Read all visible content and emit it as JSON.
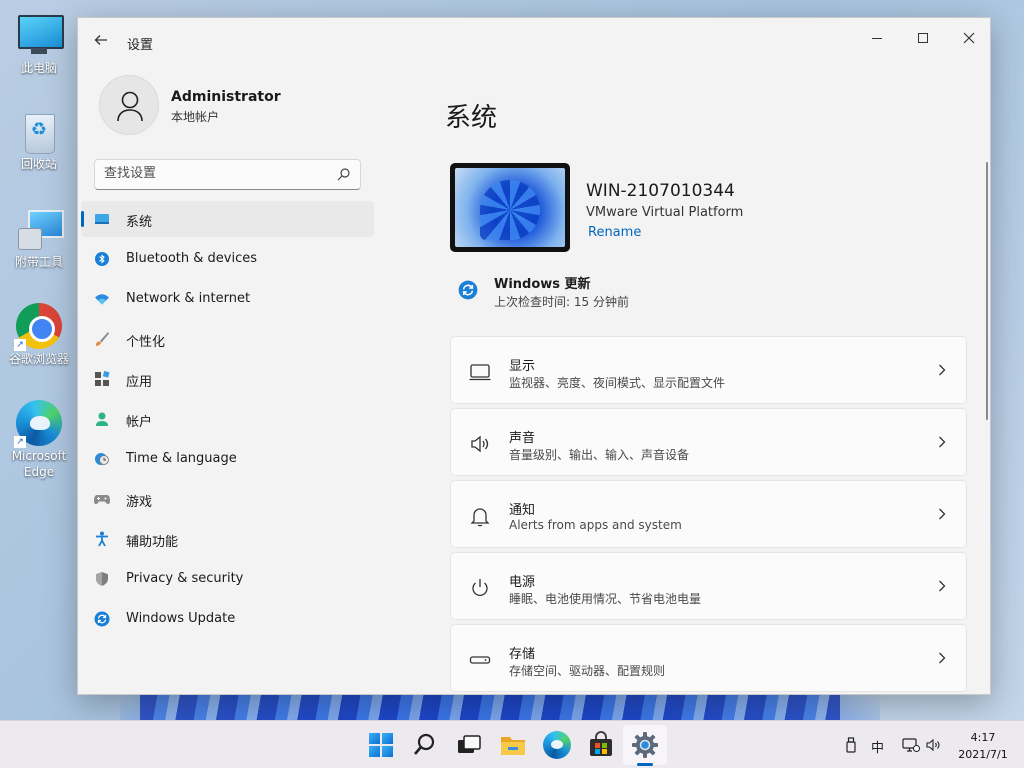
{
  "desktop": {
    "icons": [
      {
        "label": "此电脑"
      },
      {
        "label": "回收站"
      },
      {
        "label": "附带工具"
      },
      {
        "label": "谷歌浏览器"
      },
      {
        "label": "Microsoft Edge"
      }
    ]
  },
  "window": {
    "title": "设置",
    "back_icon": "arrow-left-icon",
    "controls": {
      "minimize": "minimize-icon",
      "maximize": "maximize-icon",
      "close": "close-icon"
    }
  },
  "profile": {
    "name": "Administrator",
    "account_type": "本地帐户"
  },
  "search": {
    "placeholder": "查找设置"
  },
  "nav": {
    "items": [
      {
        "label": "系统",
        "icon": "display-icon",
        "active": true
      },
      {
        "label": "Bluetooth & devices",
        "icon": "bluetooth-icon"
      },
      {
        "label": "Network & internet",
        "icon": "wifi-icon"
      },
      {
        "label": "个性化",
        "icon": "brush-icon"
      },
      {
        "label": "应用",
        "icon": "apps-icon"
      },
      {
        "label": "帐户",
        "icon": "person-icon"
      },
      {
        "label": "Time & language",
        "icon": "globe-clock-icon"
      },
      {
        "label": "游戏",
        "icon": "gamepad-icon"
      },
      {
        "label": "辅助功能",
        "icon": "accessibility-icon"
      },
      {
        "label": "Privacy & security",
        "icon": "shield-icon"
      },
      {
        "label": "Windows Update",
        "icon": "update-icon"
      }
    ]
  },
  "main": {
    "title": "系统",
    "device": {
      "name": "WIN-2107010344",
      "model": "VMware Virtual Platform",
      "rename_label": "Rename"
    },
    "update": {
      "title": "Windows 更新",
      "subtitle": "上次检查时间: 15 分钟前"
    },
    "cards": [
      {
        "title": "显示",
        "subtitle": "监视器、亮度、夜间模式、显示配置文件",
        "icon": "monitor-icon"
      },
      {
        "title": "声音",
        "subtitle": "音量级别、输出、输入、声音设备",
        "icon": "speaker-icon"
      },
      {
        "title": "通知",
        "subtitle": "Alerts from apps and system",
        "icon": "bell-icon"
      },
      {
        "title": "电源",
        "subtitle": "睡眠、电池使用情况、节省电池电量",
        "icon": "power-icon"
      },
      {
        "title": "存储",
        "subtitle": "存储空间、驱动器、配置规则",
        "icon": "storage-icon"
      }
    ]
  },
  "taskbar": {
    "ime_label": "中",
    "time": "4:17",
    "date": "2021/7/1",
    "accent": "#0067c0"
  }
}
